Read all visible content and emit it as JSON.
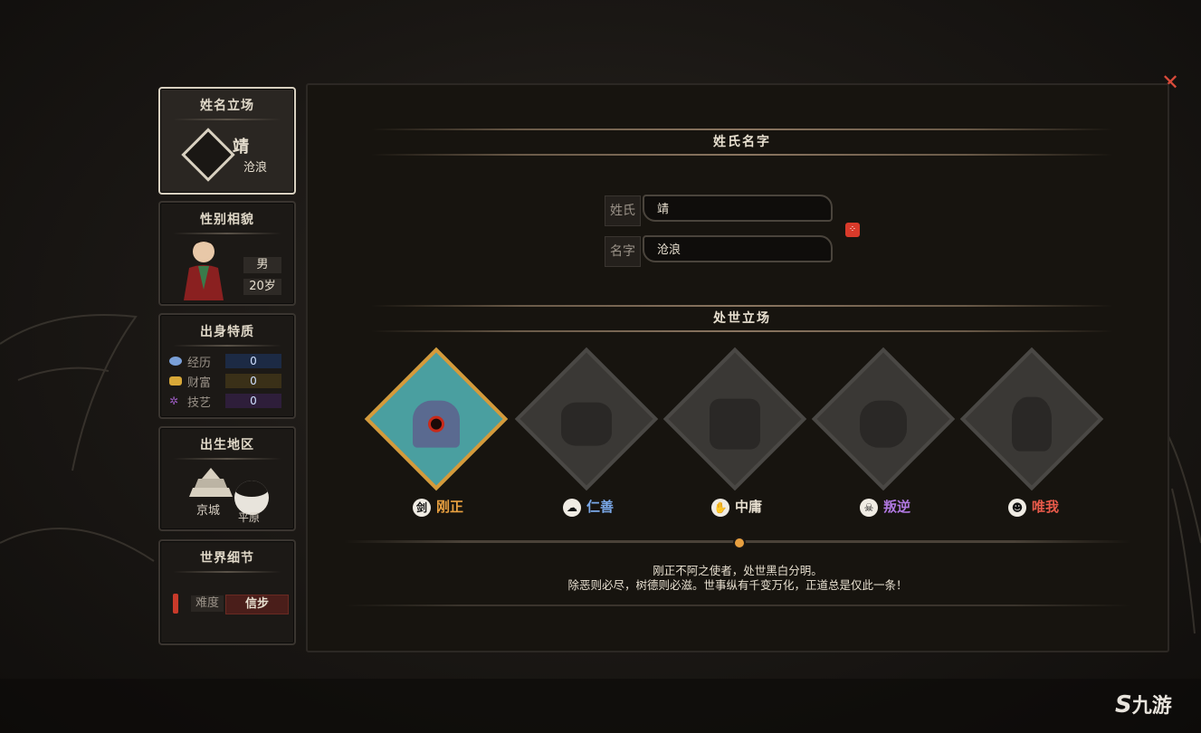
{
  "sidebar": {
    "name_card": {
      "title": "姓名立场",
      "surname": "靖",
      "given": "沧浪"
    },
    "gender_card": {
      "title": "性别相貌",
      "gender": "男",
      "age": "20岁"
    },
    "origin_card": {
      "title": "出身特质",
      "stats": [
        {
          "label": "经历",
          "value": "0",
          "color": "#4a78b8"
        },
        {
          "label": "财富",
          "value": "0",
          "color": "#c89a30"
        },
        {
          "label": "技艺",
          "value": "0",
          "color": "#8a4aa8"
        }
      ]
    },
    "birthplace_card": {
      "title": "出生地区",
      "city": "京城",
      "plain": "平原"
    },
    "world_card": {
      "title": "世界细节",
      "difficulty_label": "难度",
      "difficulty_value": "信步"
    }
  },
  "main": {
    "name_section": {
      "title": "姓氏名字",
      "surname_label": "姓氏",
      "surname_value": "靖",
      "given_label": "名字",
      "given_value": "沧浪"
    },
    "stance_section": {
      "title": "处世立场",
      "stances": [
        {
          "name": "刚正",
          "color": "#e8a040",
          "active": true
        },
        {
          "name": "仁善",
          "color": "#7aa8e8",
          "active": false
        },
        {
          "name": "中庸",
          "color": "#e8e0d0",
          "active": false
        },
        {
          "name": "叛逆",
          "color": "#b078e0",
          "active": false
        },
        {
          "name": "唯我",
          "color": "#e85a4a",
          "active": false
        }
      ],
      "description_line1": "刚正不阿之使者，处世黑白分明。",
      "description_line2": "除恶则必尽，树德则必滋。世事纵有千变万化，正道总是仅此一条！"
    }
  },
  "watermark": "九游",
  "close_icon": "close-icon"
}
